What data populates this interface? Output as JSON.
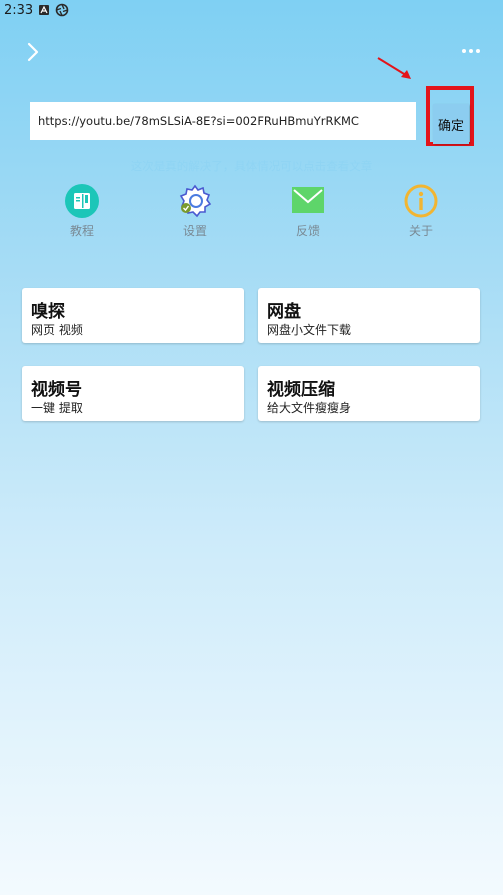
{
  "status_bar": {
    "time": "2:33"
  },
  "nav": {
    "back_icon": "chevron-right-icon",
    "more_icon": "more-dots-icon"
  },
  "url_input": {
    "value": "https://youtu.be/78mSLSiA-8E?si=002FRuHBmuYrRKMC",
    "placeholder": ""
  },
  "confirm_label": "确定",
  "hint": "这次是真的解决了，具体情况可以点击查看文章",
  "functions": [
    {
      "label": "教程",
      "icon": "book-icon",
      "color": "#1cc6b8"
    },
    {
      "label": "设置",
      "icon": "gear-icon",
      "color": "#4a7be0"
    },
    {
      "label": "反馈",
      "icon": "mail-icon",
      "color": "#5ed56a"
    },
    {
      "label": "关于",
      "icon": "info-icon",
      "color": "#f2b531"
    }
  ],
  "cards": [
    {
      "title": "嗅探",
      "subtitle": "网页 视频"
    },
    {
      "title": "网盘",
      "subtitle": "网盘小文件下载"
    },
    {
      "title": "视频号",
      "subtitle": "一键 提取"
    },
    {
      "title": "视频压缩",
      "subtitle": "给大文件瘦瘦身"
    }
  ],
  "colors": {
    "highlight_box": "#e3141a",
    "arrow": "#e3141a",
    "confirm_bg": "#8ccdf0"
  }
}
